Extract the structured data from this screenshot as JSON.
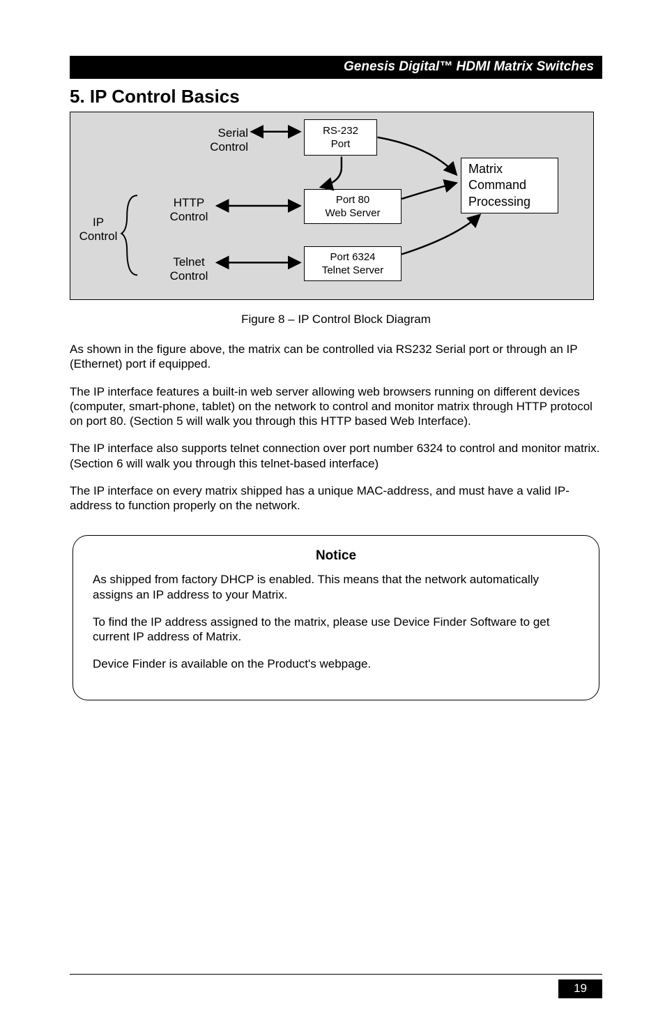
{
  "header": {
    "title": "Genesis Digital™ HDMI Matrix Switches"
  },
  "heading": "5. IP Control Basics",
  "diagram": {
    "labels": {
      "serial_control": "Serial\nControl",
      "ip_control": "IP\nControl",
      "http_control": "HTTP\nControl",
      "telnet_control": "Telnet\nControl"
    },
    "boxes": {
      "rs232": {
        "l1": "RS-232",
        "l2": "Port"
      },
      "port80": {
        "l1": "Port 80",
        "l2": "Web Server"
      },
      "port6324": {
        "l1": "Port 6324",
        "l2": "Telnet Server"
      },
      "matrix": {
        "l1": "Matrix",
        "l2": "Command",
        "l3": "Processing"
      }
    }
  },
  "figure_caption": "Figure 8 – IP Control Block Diagram",
  "paragraphs": {
    "p1": "As shown in the figure above, the matrix can be controlled via RS232 Serial port or through an IP (Ethernet) port if equipped.",
    "p2": "The IP interface features a built-in web server  allowing web browsers running on different devices (computer, smart-phone, tablet)  on the network to control and monitor matrix through HTTP protocol on port 80. (Section 5 will walk you through this HTTP based Web Interface).",
    "p3": "The IP interface also supports telnet connection over port number 6324 to control and monitor matrix. (Section 6 will walk you through this telnet-based interface)",
    "p4": "The IP interface on every matrix shipped has a unique MAC-address, and must have a valid IP-address to function properly on the network."
  },
  "notice": {
    "title": "Notice",
    "p1": "As shipped from factory DHCP is enabled. This means that the network automatically assigns an IP address to your Matrix.",
    "p2": "To find the IP address assigned to the matrix, please use Device Finder Software to get current IP address of Matrix.",
    "p3": "Device Finder is available on the Product's webpage."
  },
  "page_number": "19"
}
